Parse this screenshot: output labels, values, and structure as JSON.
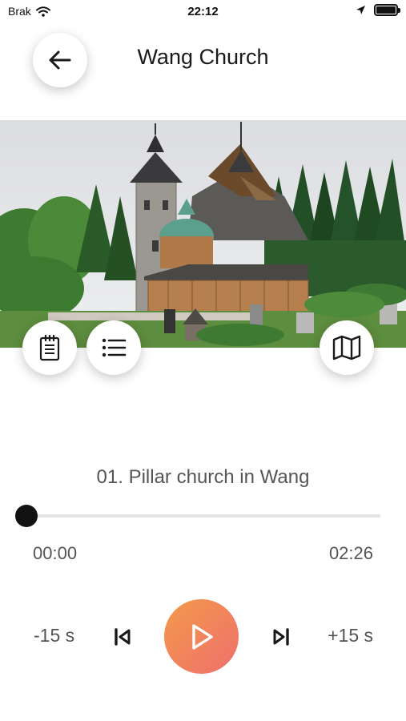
{
  "status_bar": {
    "carrier": "Brak",
    "time": "22:12",
    "icons": [
      "wifi-icon",
      "location-arrow-icon",
      "battery-icon"
    ]
  },
  "header": {
    "title": "Wang Church",
    "back_icon": "arrow-left-icon"
  },
  "hero_image": {
    "subject": "wooden stave church with stone tower, trees and graveyard"
  },
  "action_buttons": [
    {
      "icon": "notepad-icon"
    },
    {
      "icon": "list-icon"
    },
    {
      "icon": "map-icon"
    }
  ],
  "player": {
    "track_title": "01. Pillar church in Wang",
    "current_time": "00:00",
    "total_time": "02:26",
    "progress": 0,
    "rewind_label": "-15 s",
    "forward_label": "+15 s",
    "prev_icon": "skip-previous-icon",
    "play_icon": "play-icon",
    "next_icon": "skip-next-icon",
    "accent_gradient": [
      "#f39a4a",
      "#ee6f6d"
    ]
  }
}
